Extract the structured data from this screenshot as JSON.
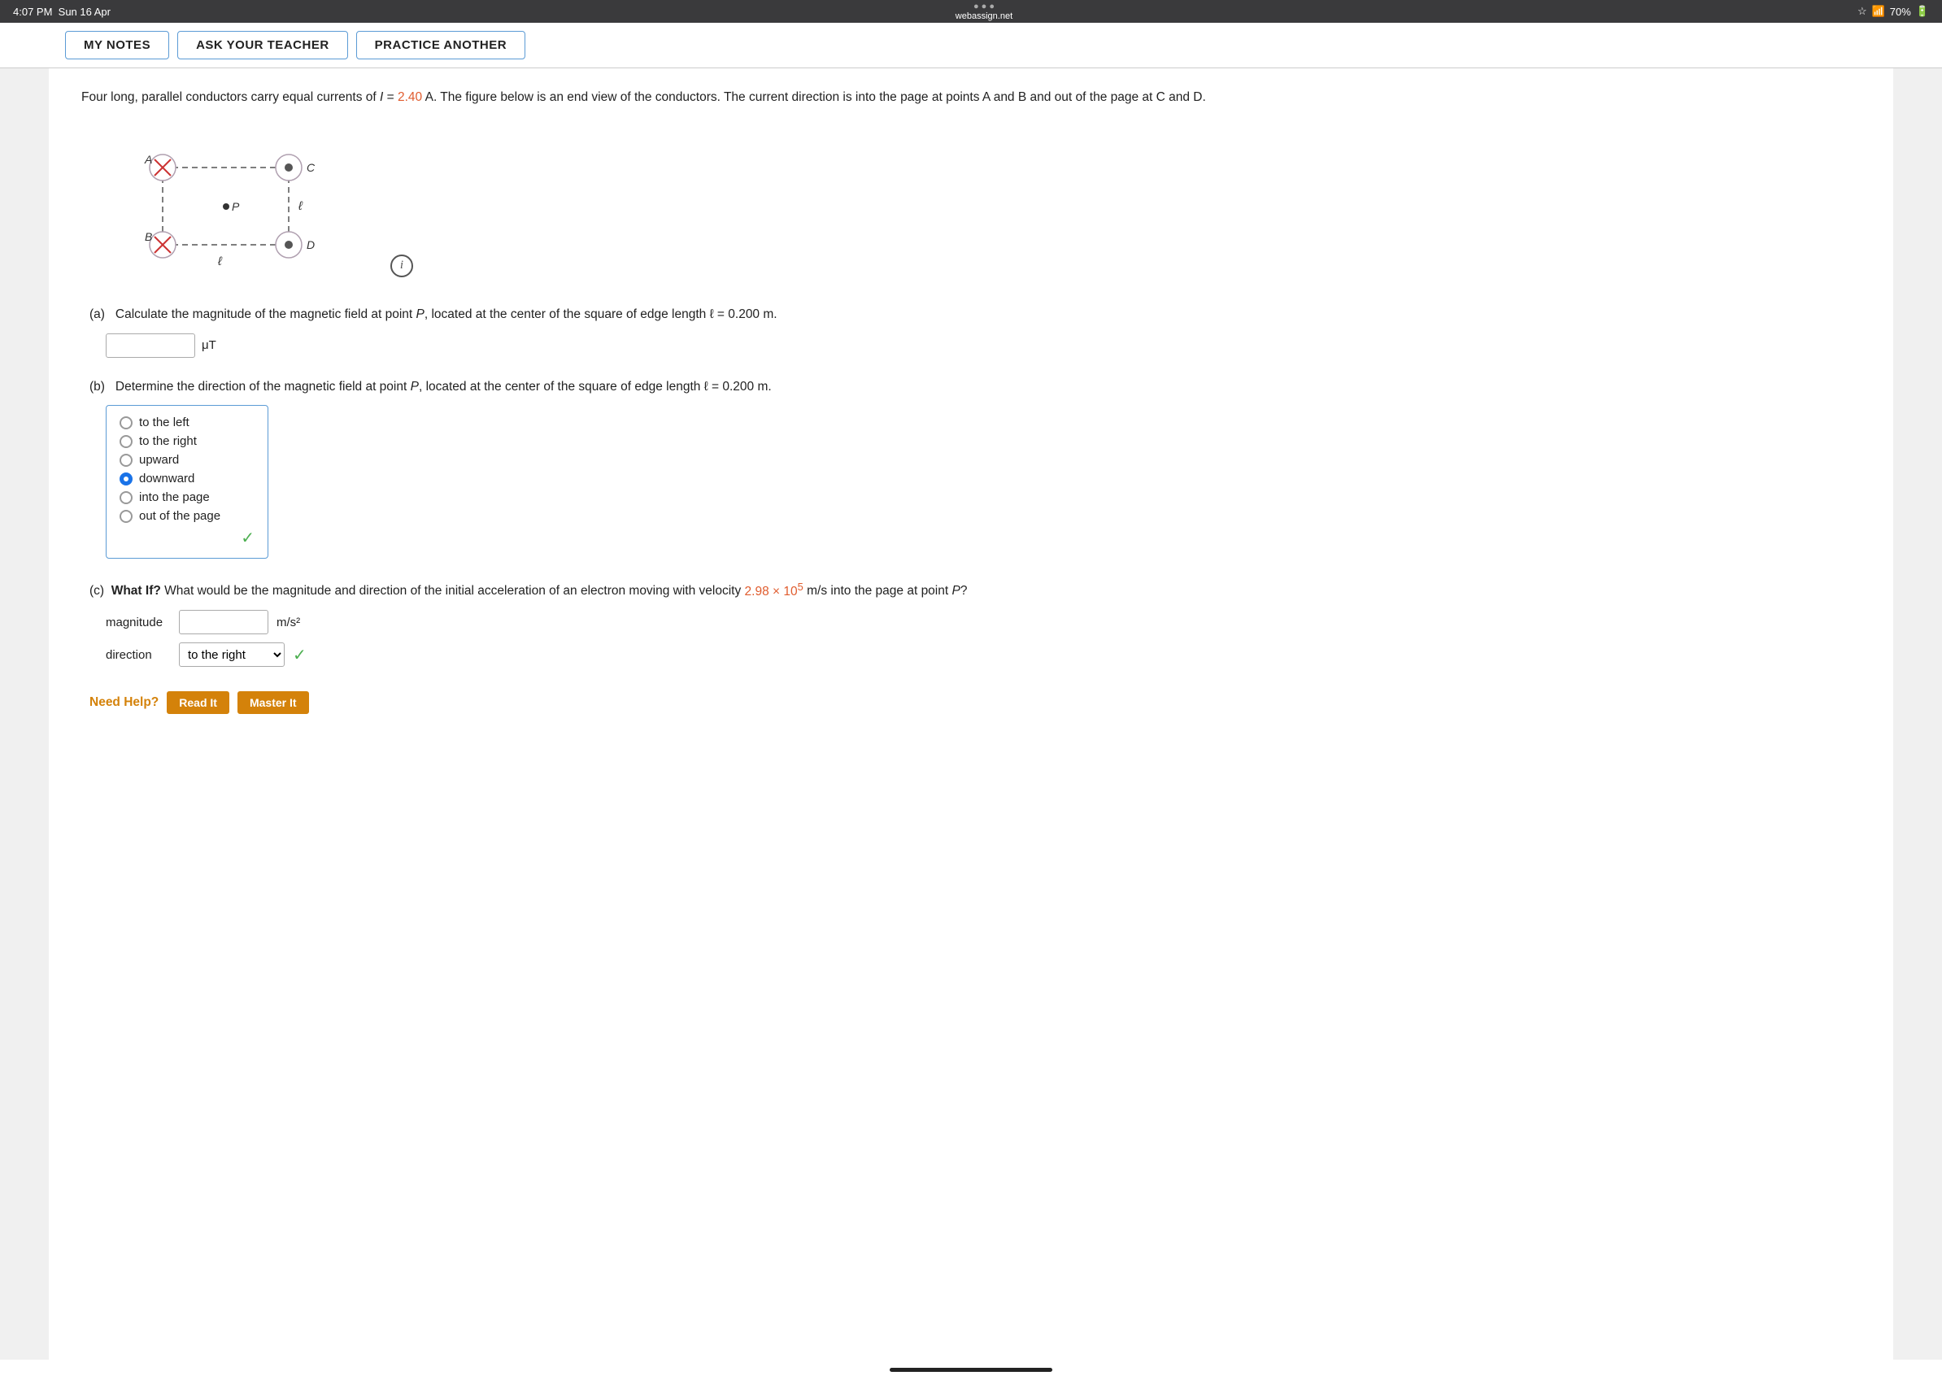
{
  "statusBar": {
    "time": "4:07 PM",
    "date": "Sun 16 Apr",
    "url": "webassign.net",
    "battery": "70%"
  },
  "topNav": {
    "btn1": "MY NOTES",
    "btn2": "ASK YOUR TEACHER",
    "btn3": "PRACTICE ANOTHER"
  },
  "problem": {
    "text_part1": "Four long, parallel conductors carry equal currents of ",
    "I_label": "I",
    "equals": " = ",
    "I_value": "2.40",
    "text_part2": " A. The figure below is an end view of the conductors. The current direction is into the page at points ",
    "text_part3": "A and B and out of the page at C and D.",
    "partA_label": "(a)",
    "partA_text": "Calculate the magnitude of the magnetic field at point ",
    "partA_P": "P",
    "partA_text2": ", located at the center of the square of edge length ℓ = 0.200 m.",
    "partA_unit": "μT",
    "partB_label": "(b)",
    "partB_text": "Determine the direction of the magnetic field at point ",
    "partB_P": "P",
    "partB_text2": ", located at the center of the square of edge length ℓ = 0.200 m.",
    "radioOptions": [
      {
        "id": "r1",
        "label": "to the left",
        "selected": false
      },
      {
        "id": "r2",
        "label": "to the right",
        "selected": false
      },
      {
        "id": "r3",
        "label": "upward",
        "selected": false
      },
      {
        "id": "r4",
        "label": "downward",
        "selected": true
      },
      {
        "id": "r5",
        "label": "into the page",
        "selected": false
      },
      {
        "id": "r6",
        "label": "out of the page",
        "selected": false
      }
    ],
    "partC_label": "(c)",
    "partC_bold": "What If?",
    "partC_text": " What would be the magnitude and direction of the initial acceleration of an electron moving with velocity ",
    "partC_velocity": "2.98 × 10",
    "partC_exp": "5",
    "partC_text2": " m/s into the page at point ",
    "partC_P": "P",
    "partC_text3": "?",
    "magnitude_label": "magnitude",
    "magnitude_unit": "m/s²",
    "direction_label": "direction",
    "direction_value": "to the right",
    "direction_options": [
      "to the left",
      "to the right",
      "upward",
      "downward",
      "into the page",
      "out of the page"
    ]
  },
  "needHelp": {
    "label": "Need Help?",
    "btn1": "Read It",
    "btn2": "Master It"
  },
  "diagram": {
    "A_label": "A",
    "B_label": "B",
    "C_label": "C",
    "D_label": "D",
    "P_label": "P",
    "l_label": "ℓ"
  }
}
